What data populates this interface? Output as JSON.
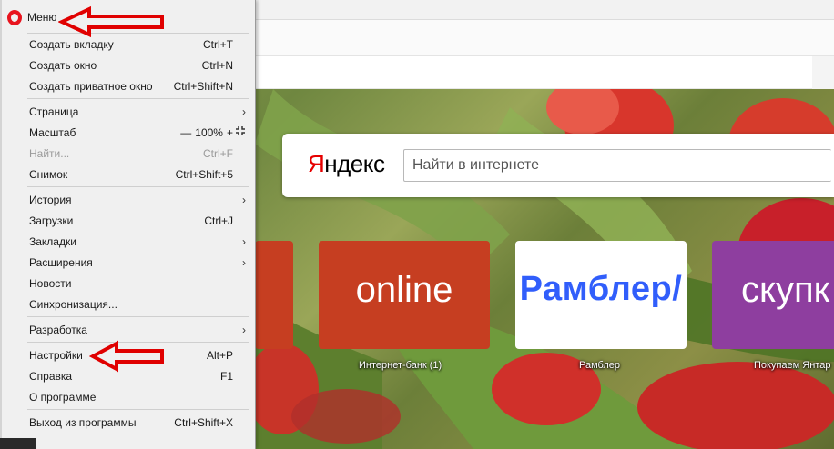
{
  "menu": {
    "title": "Меню",
    "items": [
      {
        "label": "Создать вкладку",
        "shortcut": "Ctrl+T"
      },
      {
        "label": "Создать окно",
        "shortcut": "Ctrl+N"
      },
      {
        "label": "Создать приватное окно",
        "shortcut": "Ctrl+Shift+N"
      },
      {
        "label": "Страница",
        "shortcut": ""
      },
      {
        "label": "Масштаб",
        "shortcut": ""
      },
      {
        "label": "Найти...",
        "shortcut": "Ctrl+F"
      },
      {
        "label": "Снимок",
        "shortcut": "Ctrl+Shift+5"
      },
      {
        "label": "История",
        "shortcut": ""
      },
      {
        "label": "Загрузки",
        "shortcut": "Ctrl+J"
      },
      {
        "label": "Закладки",
        "shortcut": ""
      },
      {
        "label": "Расширения",
        "shortcut": ""
      },
      {
        "label": "Новости",
        "shortcut": ""
      },
      {
        "label": "Синхронизация...",
        "shortcut": ""
      },
      {
        "label": "Разработка",
        "shortcut": ""
      },
      {
        "label": "Настройки",
        "shortcut": "Alt+P"
      },
      {
        "label": "Справка",
        "shortcut": "F1"
      },
      {
        "label": "О программе",
        "shortcut": ""
      },
      {
        "label": "Выход из программы",
        "shortcut": "Ctrl+Shift+X"
      }
    ],
    "zoom": {
      "minus": "—",
      "value": "100%",
      "plus": "+"
    }
  },
  "search": {
    "logo_first": "Я",
    "logo_rest": "ндекс",
    "placeholder": "Найти в интернете"
  },
  "tiles": [
    {
      "text": "online",
      "caption": "Интернет-банк (1)"
    },
    {
      "text": "Рамблер/",
      "caption": "Рамблер"
    },
    {
      "text": "скупк",
      "caption": "Покупаем Янтар"
    }
  ],
  "colors": {
    "opera_red": "#e8141e",
    "annotation_red": "#e00000",
    "tile_online": "#c63e21",
    "tile_rambler_text": "#315efb",
    "tile_skupka": "#8e3e9f"
  }
}
